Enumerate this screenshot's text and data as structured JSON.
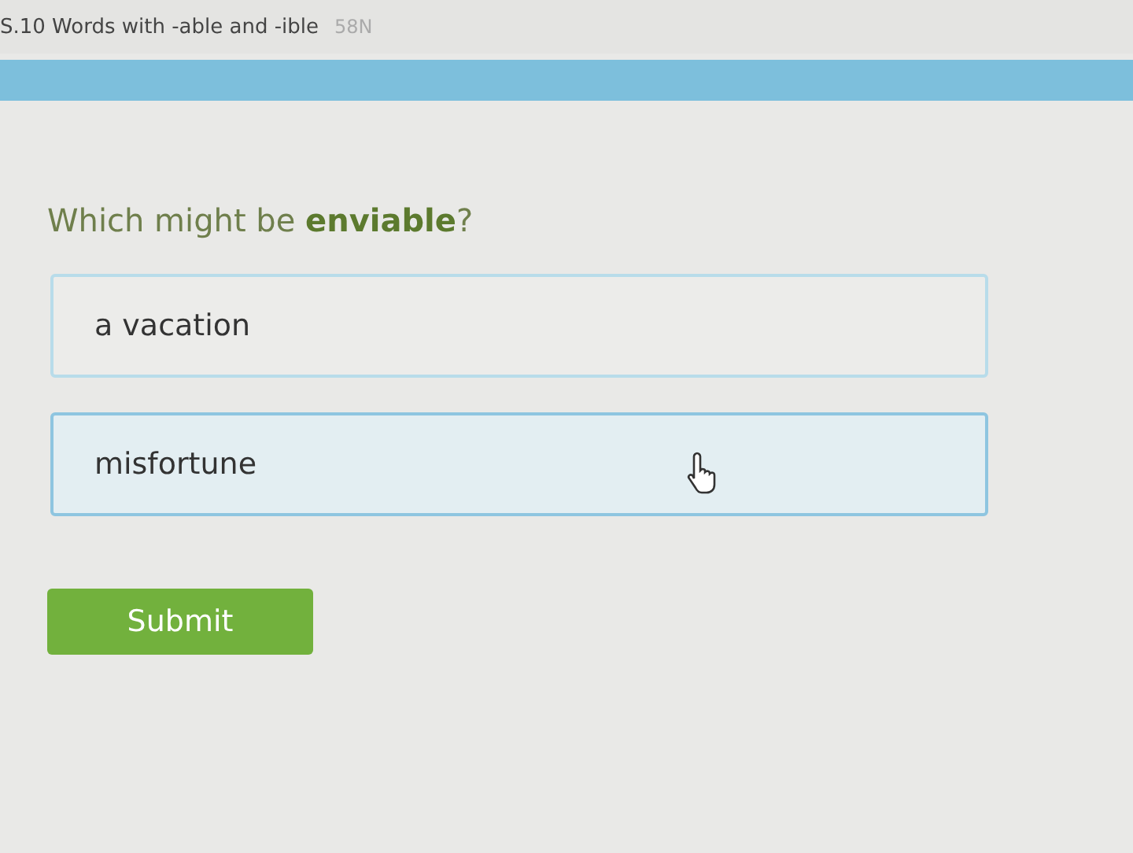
{
  "header": {
    "title": "S.10 Words with -able and -ible",
    "code": "58N"
  },
  "question": "Which might be **enviable**?",
  "options": [
    {
      "label": "a vacation",
      "selected": false,
      "hovered": false
    },
    {
      "label": "misfortune",
      "selected": false,
      "hovered": true
    }
  ],
  "submit": "Submit"
}
